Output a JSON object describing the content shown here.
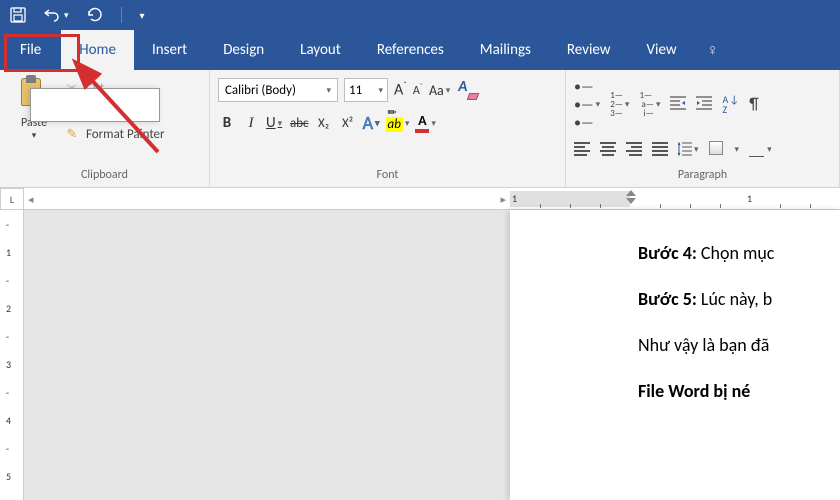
{
  "quick_access": {
    "save": "💾",
    "undo": "↶",
    "redo": "↻"
  },
  "tabs": {
    "file": "File",
    "home": "Home",
    "insert": "Insert",
    "design": "Design",
    "layout": "Layout",
    "references": "References",
    "mailings": "Mailings",
    "review": "Review",
    "view": "View",
    "tell": "♀"
  },
  "clipboard": {
    "paste": "Paste",
    "cut": "Cut",
    "copy": "Copy",
    "format_painter": "Format Painter",
    "group_label": "Clipboard"
  },
  "font": {
    "name": "Calibri (Body)",
    "size": "11",
    "grow": "A",
    "shrink": "A",
    "case": "Aa",
    "bold": "B",
    "italic": "I",
    "underline": "U",
    "strike": "abc",
    "subscript": "X₂",
    "superscript": "X²",
    "effects": "A",
    "highlight": "ab",
    "color_letter": "A",
    "color": "#d32f2f",
    "group_label": "Font"
  },
  "paragraph": {
    "bullets": "•",
    "numbering": "1",
    "multilevel": "≣",
    "dec_indent": "≤",
    "inc_indent": "≥",
    "sort_top": "A",
    "sort_bot": "Z",
    "pilcrow": "¶",
    "line_spacing": "↕",
    "group_label": "Paragraph"
  },
  "ruler": {
    "corner": "L",
    "v_ticks": [
      "-",
      "1",
      "-",
      "2",
      "-",
      "3",
      "-",
      "4",
      "-",
      "5",
      "-"
    ],
    "h_num": "1"
  },
  "document": {
    "lines": [
      {
        "bold": "Bước 4:",
        "rest": " Chọn mục"
      },
      {
        "bold": "Bước 5:",
        "rest": " Lúc này, b"
      },
      {
        "bold": "",
        "rest": "Như vậy là bạn đã"
      },
      {
        "bold": "File Word bị né",
        "rest": ""
      }
    ]
  }
}
